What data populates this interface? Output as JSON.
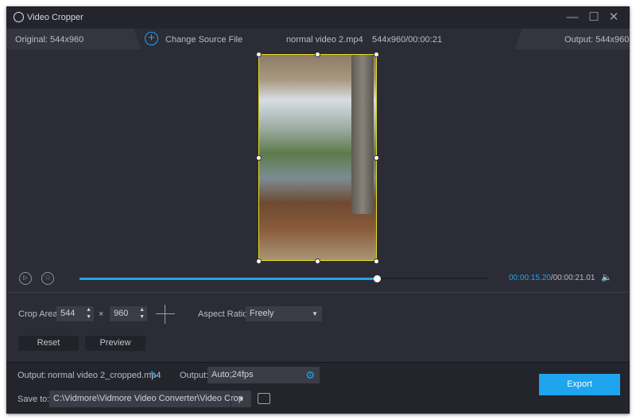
{
  "window": {
    "title": "Video Cropper"
  },
  "info": {
    "original": "Original: 544x960",
    "change_source": "Change Source File",
    "filename": "normal video 2.mp4",
    "meta": "544x960/00:00:21",
    "output": "Output: 544x960"
  },
  "playback": {
    "current": "00:00:15.20",
    "total": "/00:00:21.01",
    "progress": 0.727,
    "accent": "#20a6ee"
  },
  "crop": {
    "label": "Crop Area:",
    "width": "544",
    "times": "×",
    "height": "960",
    "aspect_label": "Aspect Ratio:",
    "aspect_value": "Freely",
    "reset": "Reset",
    "preview": "Preview"
  },
  "output": {
    "label": "Output:",
    "filename": "normal video 2_cropped.mp4",
    "format_label": "Output:",
    "format_value": "Auto;24fps",
    "save_label": "Save to:",
    "save_path": "C:\\Vidmore\\Vidmore Video Converter\\Video Crop",
    "export": "Export"
  }
}
